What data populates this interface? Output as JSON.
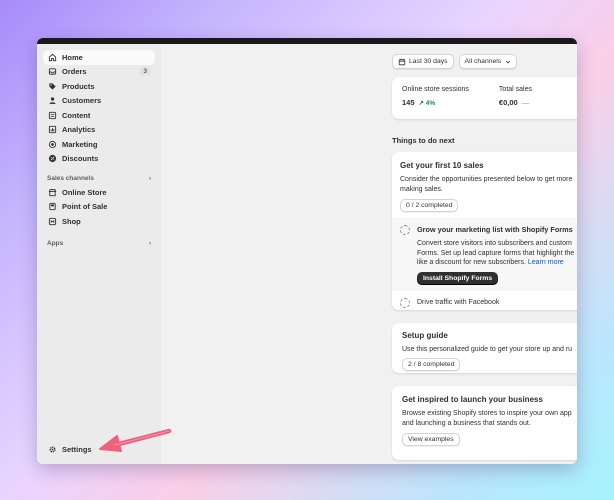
{
  "sidebar": {
    "items": [
      {
        "label": "Home",
        "icon": "home-icon"
      },
      {
        "label": "Orders",
        "icon": "orders-icon",
        "badge": "3"
      },
      {
        "label": "Products",
        "icon": "tag-icon"
      },
      {
        "label": "Customers",
        "icon": "person-icon"
      },
      {
        "label": "Content",
        "icon": "content-icon"
      },
      {
        "label": "Analytics",
        "icon": "chart-icon"
      },
      {
        "label": "Marketing",
        "icon": "target-icon"
      },
      {
        "label": "Discounts",
        "icon": "discount-icon"
      }
    ],
    "sales_channels_label": "Sales channels",
    "channels": [
      {
        "label": "Online Store",
        "icon": "store-icon"
      },
      {
        "label": "Point of Sale",
        "icon": "pos-icon"
      },
      {
        "label": "Shop",
        "icon": "shop-icon"
      }
    ],
    "apps_label": "Apps",
    "settings_label": "Settings"
  },
  "filters": {
    "date_range": "Last 30 days",
    "channels": "All channels"
  },
  "stats": {
    "sessions_title": "Online store sessions",
    "sessions_value": "145",
    "sessions_trend": "↗ 4%",
    "sales_title": "Total sales",
    "sales_value": "€0,00",
    "sales_trend": "—"
  },
  "things_title": "Things to do next",
  "first_sales": {
    "title": "Get your first 10 sales",
    "desc_line1": "Consider the opportunities presented below to get more",
    "desc_line2": "making sales.",
    "progress": "0 / 2 completed",
    "task1_title": "Grow your marketing list with Shopify Forms",
    "task1_line1": "Convert store visitors into subscribers and custom",
    "task1_line2": "Forms. Set up lead capture forms that highlight the",
    "task1_line3": "like a discount for new subscribers.",
    "task1_link": "Learn more",
    "task1_button": "Install Shopify Forms",
    "task2_title": "Drive traffic with Facebook"
  },
  "setup_guide": {
    "title": "Setup guide",
    "desc": "Use this personalized guide to get your store up and ru",
    "progress": "2 / 8 completed"
  },
  "inspire": {
    "title": "Get inspired to launch your business",
    "desc_line1": "Browse existing Shopify stores to inspire your own app",
    "desc_line2": "and launching a business that stands out.",
    "button": "View examples"
  },
  "colors": {
    "accent_arrow": "#f0607c",
    "link": "#005bd3",
    "trend_up": "#0f8a4f"
  }
}
